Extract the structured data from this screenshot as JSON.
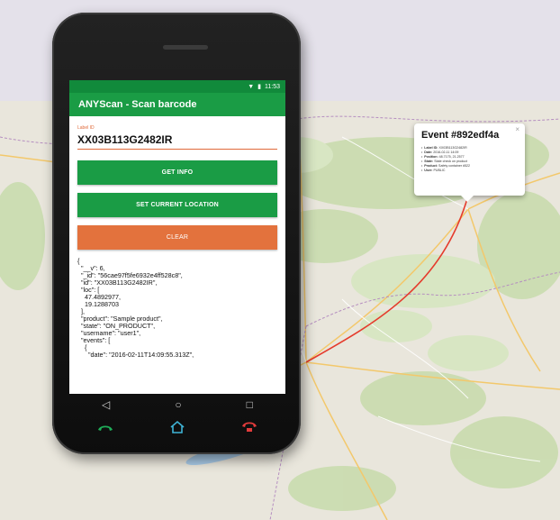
{
  "popup": {
    "title": "Event #892edf4a",
    "close": "×",
    "items": [
      {
        "key": "Label ID:",
        "value": "XX03B113G2482IR"
      },
      {
        "key": "Date:",
        "value": "2016-02-11 14:09"
      },
      {
        "key": "Position:",
        "value": "48.7175, 21.2577"
      },
      {
        "key": "State:",
        "value": "State check on product"
      },
      {
        "key": "Product:",
        "value": "Safety container #522"
      },
      {
        "key": "User:",
        "value": "PUBLIC"
      }
    ]
  },
  "status_bar": {
    "time": "11:53"
  },
  "app": {
    "title": "ANYScan - Scan barcode",
    "label_id": {
      "label": "Label ID",
      "value": "XX03B113G2482IR"
    },
    "buttons": {
      "get_info": "GET INFO",
      "set_location": "SET CURRENT LOCATION",
      "clear": "CLEAR"
    },
    "json_output": "{\n  \"__v\": 6,\n  \"_id\": \"56cae97f5fe6932e4ff528c8\",\n  \"id\": \"XX03B113G2482IR\",\n  \"loc\": [\n    47.4892977,\n    19.1288703\n  ],\n  \"product\": \"Sample product\",\n  \"state\": \"ON_PRODUCT\",\n  \"username\": \"user1\",\n  \"events\": [\n    {\n      \"date\": \"2016-02-11T14:09:55.313Z\","
  },
  "colors": {
    "app_green": "#1a9c45",
    "status_green": "#118a3b",
    "clear_orange": "#e3723d",
    "route_red": "#e53b2c"
  },
  "icons": [
    "signal-icon",
    "battery-icon",
    "back-icon",
    "home-icon",
    "recents-icon",
    "call-icon",
    "home-house-icon",
    "hangup-icon",
    "map-pin-icon"
  ]
}
